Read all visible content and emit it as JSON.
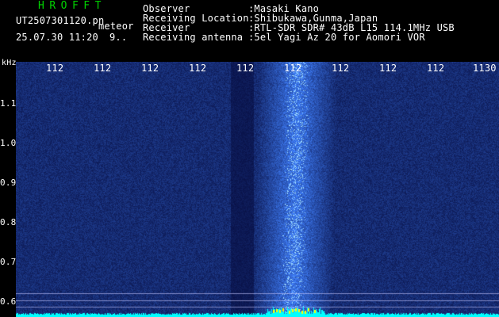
{
  "header": {
    "title": "HROFFT",
    "filename": "UT2507301120.pn",
    "tag": "meteor",
    "datetime": "25.07.30 11:20",
    "count": "9..",
    "fields": [
      {
        "label": "Observer",
        "value": ":Masaki Kano"
      },
      {
        "label": "Receiving Location",
        "value": ":Shibukawa,Gunma,Japan"
      },
      {
        "label": "Receiver",
        "value": ":RTL-SDR SDR# 43dB L15 114.1MHz USB"
      },
      {
        "label": "Receiving antenna",
        "value": ":5el Yagi Az 20 for Aomori VOR"
      }
    ]
  },
  "axes": {
    "y_unit": "kHz",
    "y_ticks": [
      "1.1",
      "1.0",
      "0.9",
      "0.8",
      "0.7",
      "0.6"
    ],
    "x_ticks": [
      "112",
      "112",
      "112",
      "112",
      "112",
      "112",
      "112",
      "112",
      "112",
      "1130"
    ]
  },
  "colors": {
    "background": "#000000",
    "title": "#00d200",
    "noise": "#0a1a8c",
    "signal": "#5ab4ff",
    "baseline": "#00ffff"
  }
}
